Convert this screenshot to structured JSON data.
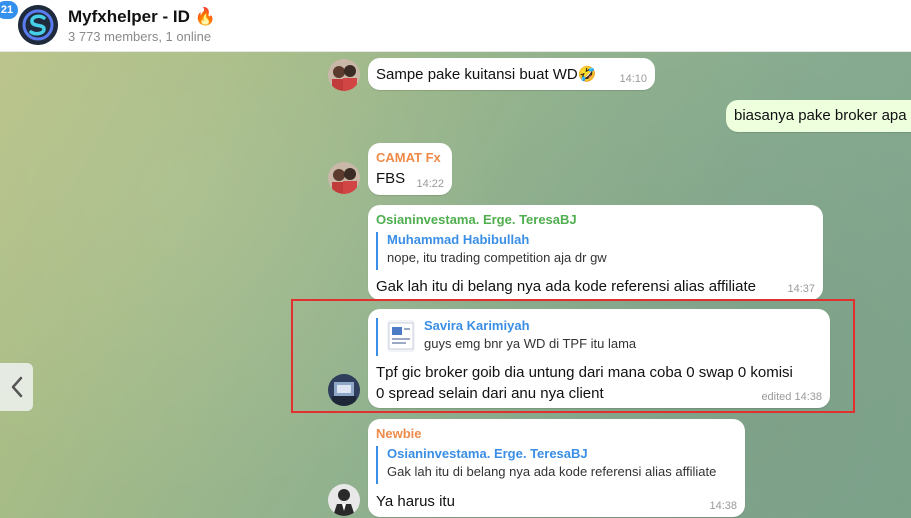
{
  "header": {
    "unread_count": "21",
    "title": "Myfxhelper - ID 🔥",
    "subtitle": "3 773 members, 1 online"
  },
  "messages": [
    {
      "text": "Sampe pake kuitansi buat WD🤣",
      "time": "14:10"
    },
    {
      "text": "biasanya pake broker apa",
      "outgoing": true
    },
    {
      "sender": "CAMAT Fx",
      "sender_color": "#ef8b4a",
      "text": "FBS",
      "time": "14:22"
    },
    {
      "sender": "Osianinvestama. Erge. TeresaBJ",
      "sender_color": "#4fae4e",
      "reply_name": "Muhammad Habibullah",
      "reply_text": "nope, itu trading competition aja dr gw",
      "text": "Gak lah itu di belang nya ada kode referensi alias affiliate",
      "time": "14:37"
    },
    {
      "reply_name": "Savira Karimiyah",
      "reply_text": "guys emg bnr ya WD di TPF itu lama",
      "text_line1": "Tpf gic broker goib dia untung dari mana coba 0 swap 0 komisi",
      "text_line2": "0 spread selain dari anu nya client",
      "time": "edited 14:38"
    },
    {
      "sender": "Newbie",
      "sender_color": "#ef8b4a",
      "reply_name": "Osianinvestama. Erge. TeresaBJ",
      "reply_text": "Gak lah itu di belang nya ada kode referensi alias affiliate",
      "text": "Ya harus itu",
      "time": "14:38"
    }
  ],
  "colors": {
    "accent": "#3390ec",
    "highlight": "#e03030",
    "incoming_bubble": "#ffffff",
    "outgoing_bubble": "#eeffde"
  },
  "icons": {
    "nav_left": "chevron-left-icon",
    "group_avatar": "s-logo-icon"
  }
}
